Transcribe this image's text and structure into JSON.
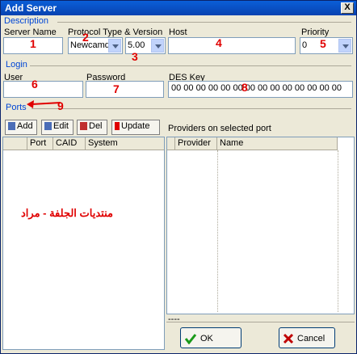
{
  "window": {
    "title": "Add Server",
    "close_label": "X"
  },
  "description": {
    "group": "Description",
    "server_name_label": "Server Name",
    "server_name_value": "",
    "protocol_label": "Protocol Type & Version",
    "protocol_value": "Newcamd",
    "version_value": "5.00",
    "host_label": "Host",
    "host_value": "",
    "priority_label": "Priority",
    "priority_value": "0"
  },
  "login": {
    "group": "Login",
    "user_label": "User",
    "user_value": "",
    "password_label": "Password",
    "password_value": "",
    "des_key_label": "DES Key",
    "des_key_value": "00 00 00 00 00 00 00 00 00 00 00 00 00 00"
  },
  "ports": {
    "group": "Ports",
    "add_label": "Add",
    "edit_label": "Edit",
    "del_label": "Del",
    "update_label": "Update",
    "columns": [
      "Port",
      "CAID",
      "System"
    ],
    "watermark": "منتديات الجلفة - مراد"
  },
  "providers": {
    "title": "Providers on selected port",
    "columns": [
      "Provider",
      "Name"
    ],
    "footer": "----"
  },
  "buttons": {
    "ok": "OK",
    "cancel": "Cancel"
  },
  "annotations": [
    "1",
    "2",
    "3",
    "4",
    "5",
    "6",
    "7",
    "8",
    "9"
  ],
  "colors": {
    "annotation": "#e00000",
    "group_label": "#0046d5",
    "title_bar": "#0842b0"
  }
}
